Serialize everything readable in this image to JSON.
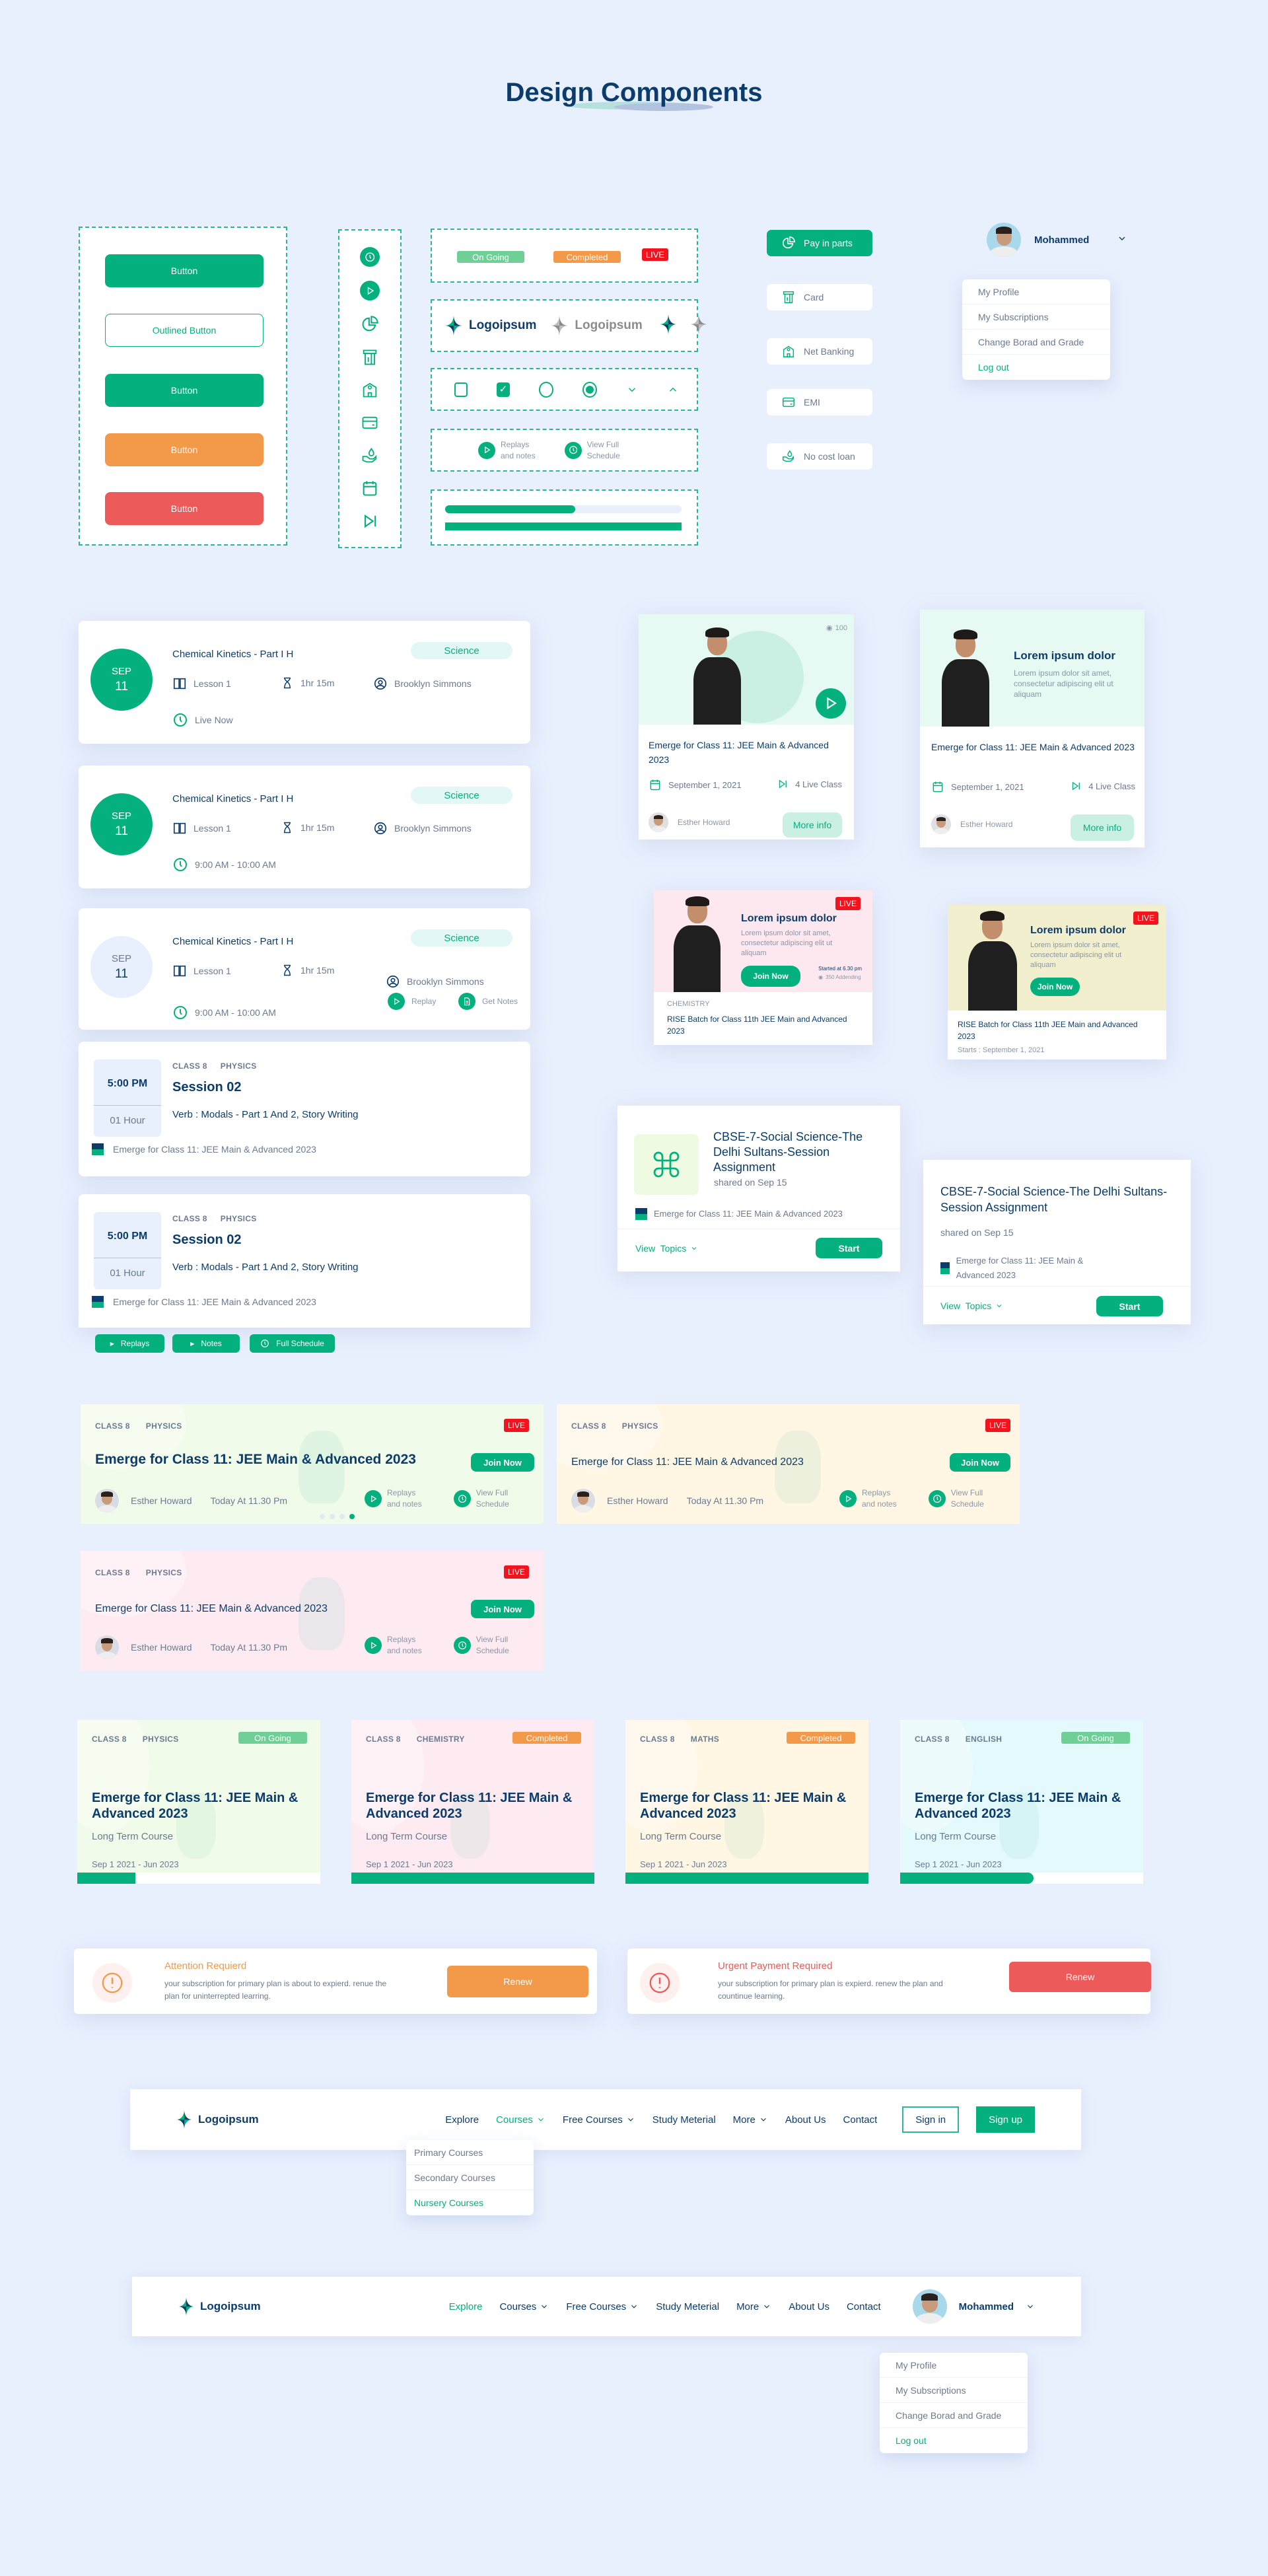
{
  "title": "Design Components",
  "buttons": [
    "Button",
    "Outlined Button",
    "Button",
    "Button",
    "Button"
  ],
  "icon_column": [
    "clock-icon",
    "play-icon",
    "pie-chart-icon",
    "card-icon",
    "bank-icon",
    "credit-card-icon",
    "loan-icon",
    "calendar-icon",
    "skip-icon"
  ],
  "badges": {
    "ongoing": "On Going",
    "completed": "Completed",
    "live": "LIVE"
  },
  "logo_text": "Logoipsum",
  "actions": {
    "replays_1": "Replays",
    "replays_2": "and notes",
    "schedule_1": "View Full",
    "schedule_2": "Schedule"
  },
  "progress": [
    0.55,
    1.0
  ],
  "payment": [
    {
      "label": "Pay in parts",
      "icon": "pie-chart-icon",
      "active": true
    },
    {
      "label": "Card",
      "icon": "card-icon"
    },
    {
      "label": "Net Banking",
      "icon": "bank-icon"
    },
    {
      "label": "EMI",
      "icon": "credit-card-icon"
    },
    {
      "label": "No cost loan",
      "icon": "loan-icon"
    }
  ],
  "profile": {
    "name": "Mohammed",
    "menu": [
      "My Profile",
      "My Subscriptions",
      "Change Borad and Grade",
      "Log out"
    ]
  },
  "schedule_cards": [
    {
      "month": "SEP",
      "day": "11",
      "title": "Chemical Kinetics - Part I H",
      "subject": "Science",
      "lesson": "Lesson 1",
      "duration": "1hr 15m",
      "teacher": "Brooklyn Simmons",
      "time": "Live Now"
    },
    {
      "month": "SEP",
      "day": "11",
      "title": "Chemical Kinetics - Part I H",
      "subject": "Science",
      "lesson": "Lesson 1",
      "duration": "1hr 15m",
      "teacher": "Brooklyn Simmons",
      "time": "9:00 AM - 10:00 AM"
    },
    {
      "month": "SEP",
      "day": "11",
      "title": "Chemical Kinetics - Part I H",
      "subject": "Science",
      "lesson": "Lesson 1",
      "duration": "1hr 15m",
      "teacher": "Brooklyn Simmons",
      "time": "9:00 AM - 10:00 AM",
      "replay": "Replay",
      "notes": "Get Notes"
    }
  ],
  "session_cards": [
    {
      "class": "CLASS 8",
      "subject": "PHYSICS",
      "time": "5:00 PM",
      "duration": "01 Hour",
      "title": "Session 02",
      "topic": "Verb : Modals - Part 1 And 2, Story Writing",
      "course": "Emerge for Class 11: JEE Main & Advanced 2023"
    },
    {
      "class": "CLASS 8",
      "subject": "PHYSICS",
      "time": "5:00 PM",
      "duration": "01 Hour",
      "title": "Session 02",
      "topic": "Verb : Modals - Part 1 And 2, Story Writing",
      "course": "Emerge for Class 11: JEE Main & Advanced 2023"
    }
  ],
  "session_buttons": [
    "Replays",
    "Notes",
    "Full Schedule"
  ],
  "course_cards": [
    {
      "views": "100",
      "title": "Emerge for Class 11: JEE Main & Advanced 2023",
      "date": "September 1, 2021",
      "live_count": "4 Live Class",
      "teacher": "Esther Howard",
      "more": "More info"
    },
    {
      "heading": "Lorem ipsum dolor",
      "body": "Lorem ipsum dolor sit amet, consectetur adipiscing elit ut aliquam",
      "title": "Emerge for Class 11: JEE Main & Advanced 2023",
      "date": "September 1, 2021",
      "live_count": "4 Live Class",
      "teacher": "Esther Howard",
      "more": "More info"
    }
  ],
  "promo_cards": [
    {
      "live": "LIVE",
      "heading": "Lorem ipsum dolor",
      "body": "Lorem ipsum dolor sit amet, consectetur adipiscing elit ut aliquam",
      "join": "Join Now",
      "started": "Started at 6.30 pm",
      "attending": "350 Addending",
      "category": "CHEMISTRY",
      "title": "RISE Batch for Class 11th JEE Main and Advanced 2023",
      "bg": "#fde8f0"
    },
    {
      "live": "LIVE",
      "heading": "Lorem ipsum dolor",
      "body": "Lorem ipsum dolor sit amet, consectetur adipiscing elit ut aliquam",
      "join": "Join Now",
      "title": "RISE Batch for Class 11th JEE Main and Advanced 2023",
      "starts": "Starts : September 1, 2021",
      "bg": "#f2efcf"
    }
  ],
  "assignments": [
    {
      "title": "CBSE-7-Social Science-The Delhi Sultans-Session Assignment",
      "shared": "shared on Sep 15",
      "course": "Emerge for Class 11: JEE Main & Advanced 2023",
      "view_topics": "View  Topics",
      "start": "Start"
    },
    {
      "title": "CBSE-7-Social Science-The Delhi Sultans-Session Assignment",
      "shared": "shared on Sep 15",
      "course": "Emerge for Class 11: JEE Main & Advanced 2023",
      "view_topics": "View  Topics",
      "start": "Start"
    }
  ],
  "live_banners": [
    {
      "class": "CLASS 8",
      "subject": "PHYSICS",
      "live": "LIVE",
      "title": "Emerge for Class 11: JEE Main & Advanced 2023",
      "join": "Join Now",
      "teacher": "Esther Howard",
      "time": "Today At 11.30 Pm",
      "bg": "#f1fbe9",
      "carousel_active": 3,
      "carousel_count": 4
    },
    {
      "class": "CLASS 8",
      "subject": "PHYSICS",
      "live": "LIVE",
      "title": "Emerge for Class 11: JEE Main & Advanced 2023",
      "join": "Join Now",
      "teacher": "Esther Howard",
      "time": "Today At 11.30 Pm",
      "bg": "#fff6e3"
    },
    {
      "class": "CLASS 8",
      "subject": "PHYSICS",
      "live": "LIVE",
      "title": "Emerge for Class 11: JEE Main & Advanced 2023",
      "join": "Join Now",
      "teacher": "Esther Howard",
      "time": "Today At 11.30 Pm",
      "bg": "#fdebf1"
    }
  ],
  "term_cards": [
    {
      "class": "CLASS 8",
      "subject": "PHYSICS",
      "status": "On Going",
      "status_color": "#6fcf97",
      "title": "Emerge for Class 11: JEE Main & Advanced 2023",
      "type": "Long Term Course",
      "dates": "Sep 1 2021 - Jun 2023",
      "progress": 0.24,
      "bg": "#f1fbe9"
    },
    {
      "class": "CLASS 8",
      "subject": "CHEMISTRY",
      "status": "Completed",
      "status_color": "#f39a4a",
      "title": "Emerge for Class 11: JEE Main & Advanced 2023",
      "type": "Long Term Course",
      "dates": "Sep 1 2021 - Jun 2023",
      "progress": 1.0,
      "bg": "#fdebf1"
    },
    {
      "class": "CLASS 8",
      "subject": "MATHS",
      "status": "Completed",
      "status_color": "#f39a4a",
      "title": "Emerge for Class 11: JEE Main & Advanced 2023",
      "type": "Long Term Course",
      "dates": "Sep 1 2021 - Jun 2023",
      "progress": 1.0,
      "bg": "#fff6e3"
    },
    {
      "class": "CLASS 8",
      "subject": "ENGLISH",
      "status": "On Going",
      "status_color": "#6fcf97",
      "title": "Emerge for Class 11: JEE Main & Advanced 2023",
      "type": "Long Term Course",
      "dates": "Sep 1 2021 - Jun 2023",
      "progress": 0.55,
      "bg": "#e3f9fb"
    }
  ],
  "alerts": [
    {
      "title": "Attention Requierd",
      "body": "your subscription for primary plan is about to expierd. renue the plan  for uninterrepted  learring.",
      "button": "Renew",
      "color": "#f39a4a"
    },
    {
      "title": "Urgent Payment Required",
      "body": "your subscription for primary plan is expierd. renew the plan and countinue learning.",
      "button": "Renew",
      "color": "#ec5a5a"
    }
  ],
  "navbar1": {
    "items": [
      {
        "label": "Explore"
      },
      {
        "label": "Courses",
        "dropdown": true,
        "active": true
      },
      {
        "label": "Free Courses",
        "dropdown": true
      },
      {
        "label": "Study Meterial"
      },
      {
        "label": "More",
        "dropdown": true
      },
      {
        "label": "About Us"
      },
      {
        "label": "Contact"
      }
    ],
    "sign_in": "Sign in",
    "sign_up": "Sign up",
    "dropdown": [
      "Primary Courses",
      "Secondary Courses",
      "Nursery Courses"
    ]
  },
  "navbar2": {
    "items": [
      {
        "label": "Explore",
        "active": true
      },
      {
        "label": "Courses",
        "dropdown": true
      },
      {
        "label": "Free Courses",
        "dropdown": true
      },
      {
        "label": "Study Meterial"
      },
      {
        "label": "More",
        "dropdown": true
      },
      {
        "label": "About Us"
      },
      {
        "label": "Contact"
      }
    ],
    "user": "Mohammed",
    "menu": [
      "My Profile",
      "My Subscriptions",
      "Change Borad and Grade",
      "Log out"
    ]
  }
}
